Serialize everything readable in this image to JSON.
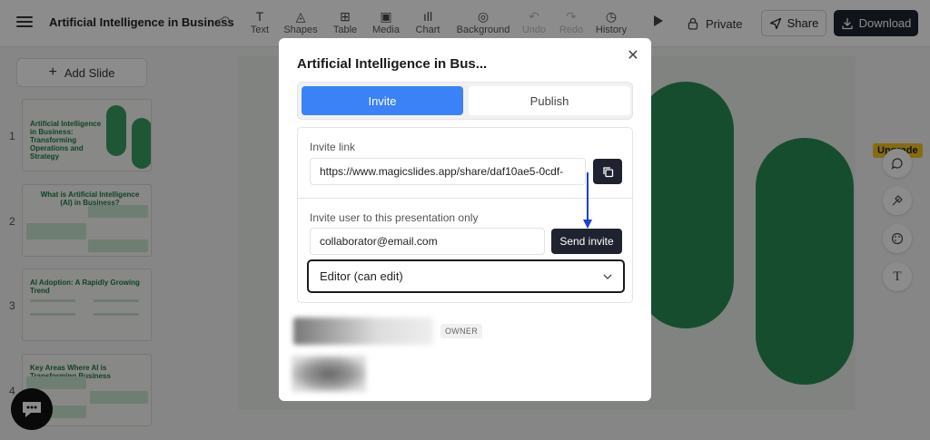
{
  "header": {
    "title": "Artificial Intelligence in Business",
    "tools": [
      {
        "label": "Text",
        "icon": "text-icon",
        "glyph": "T",
        "disabled": false
      },
      {
        "label": "Shapes",
        "icon": "shapes-icon",
        "glyph": "◬",
        "disabled": false
      },
      {
        "label": "Table",
        "icon": "table-icon",
        "glyph": "⊞",
        "disabled": false
      },
      {
        "label": "Media",
        "icon": "media-icon",
        "glyph": "▣",
        "disabled": false
      },
      {
        "label": "Chart",
        "icon": "chart-icon",
        "glyph": "ıll",
        "disabled": false
      },
      {
        "label": "Background",
        "icon": "palette-icon",
        "glyph": "◎",
        "disabled": false
      },
      {
        "label": "Undo",
        "icon": "undo-icon",
        "glyph": "↶",
        "disabled": true
      },
      {
        "label": "Redo",
        "icon": "redo-icon",
        "glyph": "↷",
        "disabled": true
      },
      {
        "label": "History",
        "icon": "history-icon",
        "glyph": "◷",
        "disabled": false
      }
    ],
    "private_label": "Private",
    "share_label": "Share",
    "download_label": "Download"
  },
  "sidebar": {
    "add_slide_label": "Add Slide",
    "slides": [
      {
        "number": "1",
        "title": "Artificial Intelligence in Business: Transforming Operations and Strategy"
      },
      {
        "number": "2",
        "title": "What is Artificial Intelligence (AI) in Business?"
      },
      {
        "number": "3",
        "title": "AI Adoption: A Rapidly Growing Trend"
      },
      {
        "number": "4",
        "title": "Key Areas Where AI is Transforming Business"
      }
    ]
  },
  "right_toolbar": {
    "upgrade_label": "Upgrade"
  },
  "modal": {
    "title": "Artificial Intelligence in Bus...",
    "tabs": [
      "Invite",
      "Publish"
    ],
    "invite_link_label": "Invite link",
    "invite_link_value": "https://www.magicslides.app/share/daf10ae5-0cdf-",
    "invite_user_label": "Invite user to this presentation only",
    "email_value": "collaborator@email.com",
    "send_label": "Send invite",
    "role_value": "Editor (can edit)",
    "owner_badge": "OWNER"
  },
  "colors": {
    "primary": "#3b82f6",
    "dark": "#1f2330",
    "slide_green": "#2b8d57",
    "upgrade": "#f3c51c",
    "annotation_arrow": "#1d3fd6"
  }
}
